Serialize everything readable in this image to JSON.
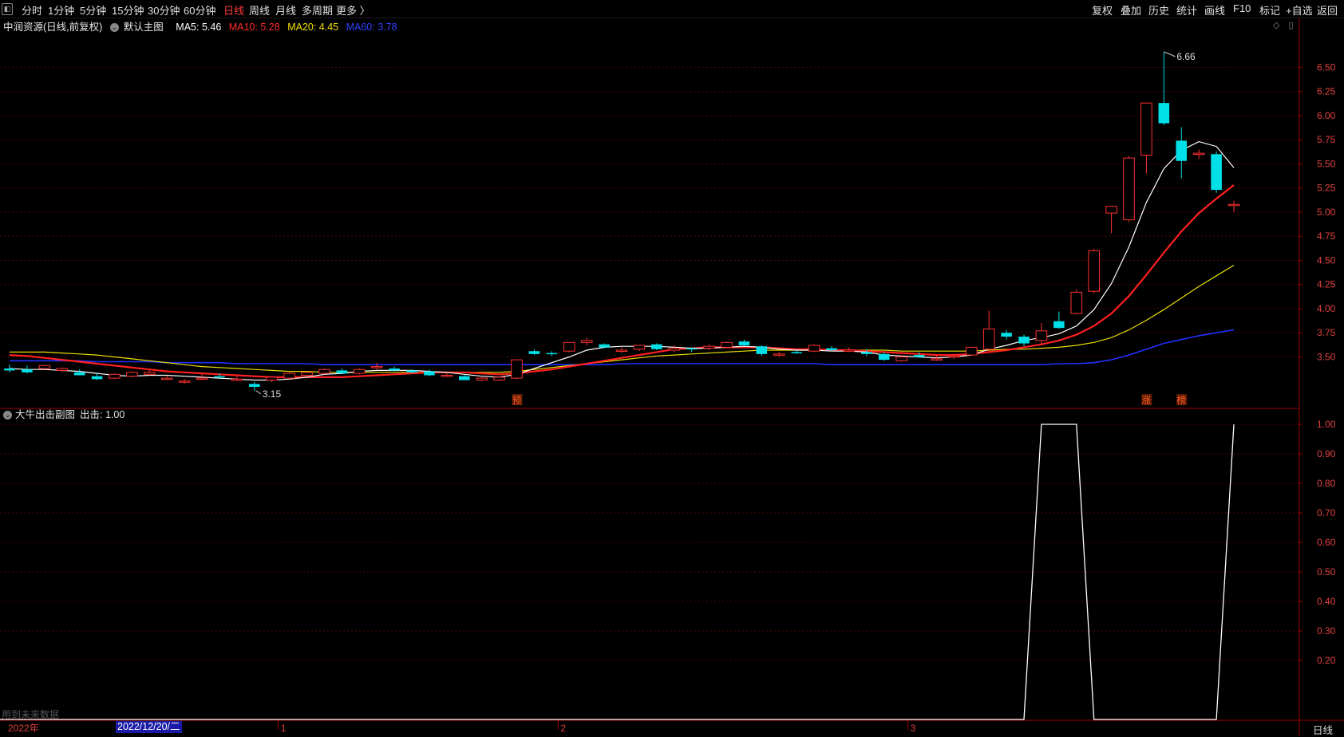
{
  "toolbar": {
    "tabs": [
      {
        "label": "分时",
        "active": false
      },
      {
        "label": "1分钟",
        "active": false
      },
      {
        "label": "5分钟",
        "active": false
      },
      {
        "label": "15分钟",
        "active": false
      },
      {
        "label": "30分钟",
        "active": false
      },
      {
        "label": "60分钟",
        "active": false
      },
      {
        "label": "日线",
        "active": true
      },
      {
        "label": "周线",
        "active": false
      },
      {
        "label": "月线",
        "active": false
      },
      {
        "label": "多周期",
        "active": false
      },
      {
        "label": "更多 〉",
        "active": false
      }
    ],
    "right_buttons": [
      "复权",
      "叠加",
      "历史",
      "统计",
      "画线",
      "F10",
      "标记",
      "+自选",
      "返回"
    ]
  },
  "main_legend": {
    "stock": "中润资源(日线,前复权)",
    "chart_name": "默认主图",
    "ma5": "MA5: 5.46",
    "ma10": "MA10: 5.28",
    "ma20": "MA20: 4.45",
    "ma60": "MA60: 3.78"
  },
  "sub_legend": {
    "name": "大牛出击副图",
    "value": "出击: 1.00"
  },
  "x_axis": {
    "year_label": "2022年",
    "cursor_date": "2022/12/20/二",
    "months": [
      "1",
      "2",
      "3"
    ]
  },
  "footer": {
    "future_data_note": "用到未来数据",
    "period": "日线"
  },
  "markers": {
    "high_label": "6.66",
    "low_label": "3.15",
    "yu": "预",
    "zhang": "涨",
    "bang": "榜"
  },
  "colors": {
    "up": "#ff3030",
    "down": "#00e0e8",
    "ma5": "#ffffff",
    "ma10": "#ff2020",
    "ma20": "#e8e000",
    "ma60": "#2030ff",
    "axis": "#a00000",
    "grid": "#5a0000"
  },
  "chart_data": [
    {
      "type": "candlestick",
      "y_ticks": [
        6.5,
        6.25,
        6.0,
        5.75,
        5.5,
        5.25,
        5.0,
        4.75,
        4.5,
        4.25,
        4.0,
        3.75,
        3.5
      ],
      "ylim": [
        3.0,
        6.85
      ],
      "candles": [
        [
          3.38,
          3.42,
          3.34,
          3.36
        ],
        [
          3.37,
          3.41,
          3.33,
          3.34
        ],
        [
          3.38,
          3.42,
          3.37,
          3.41
        ],
        [
          3.36,
          3.39,
          3.34,
          3.38
        ],
        [
          3.34,
          3.37,
          3.31,
          3.31
        ],
        [
          3.3,
          3.33,
          3.26,
          3.27
        ],
        [
          3.28,
          3.33,
          3.27,
          3.32
        ],
        [
          3.3,
          3.35,
          3.29,
          3.34
        ],
        [
          3.32,
          3.36,
          3.31,
          3.34
        ],
        [
          3.27,
          3.3,
          3.26,
          3.28
        ],
        [
          3.25,
          3.27,
          3.22,
          3.25
        ],
        [
          3.28,
          3.32,
          3.26,
          3.28
        ],
        [
          3.3,
          3.33,
          3.27,
          3.29
        ],
        [
          3.27,
          3.3,
          3.25,
          3.27
        ],
        [
          3.22,
          3.24,
          3.15,
          3.19
        ],
        [
          3.26,
          3.29,
          3.24,
          3.29
        ],
        [
          3.28,
          3.34,
          3.27,
          3.33
        ],
        [
          3.31,
          3.35,
          3.3,
          3.34
        ],
        [
          3.33,
          3.38,
          3.32,
          3.37
        ],
        [
          3.36,
          3.38,
          3.33,
          3.33
        ],
        [
          3.33,
          3.38,
          3.32,
          3.37
        ],
        [
          3.39,
          3.44,
          3.37,
          3.4
        ],
        [
          3.38,
          3.4,
          3.35,
          3.36
        ],
        [
          3.36,
          3.37,
          3.33,
          3.34
        ],
        [
          3.35,
          3.37,
          3.3,
          3.31
        ],
        [
          3.3,
          3.33,
          3.29,
          3.31
        ],
        [
          3.3,
          3.32,
          3.26,
          3.26
        ],
        [
          3.26,
          3.29,
          3.25,
          3.28
        ],
        [
          3.26,
          3.29,
          3.25,
          3.29
        ],
        [
          3.28,
          3.46,
          3.27,
          3.47
        ],
        [
          3.56,
          3.58,
          3.52,
          3.53
        ],
        [
          3.54,
          3.56,
          3.51,
          3.53
        ],
        [
          3.56,
          3.65,
          3.55,
          3.65
        ],
        [
          3.65,
          3.7,
          3.62,
          3.67
        ],
        [
          3.63,
          3.64,
          3.59,
          3.6
        ],
        [
          3.57,
          3.6,
          3.54,
          3.57
        ],
        [
          3.58,
          3.62,
          3.56,
          3.62
        ],
        [
          3.63,
          3.64,
          3.57,
          3.58
        ],
        [
          3.57,
          3.62,
          3.55,
          3.59
        ],
        [
          3.59,
          3.6,
          3.55,
          3.58
        ],
        [
          3.59,
          3.63,
          3.57,
          3.61
        ],
        [
          3.6,
          3.66,
          3.59,
          3.65
        ],
        [
          3.66,
          3.68,
          3.61,
          3.62
        ],
        [
          3.61,
          3.62,
          3.51,
          3.53
        ],
        [
          3.53,
          3.55,
          3.5,
          3.53
        ],
        [
          3.55,
          3.57,
          3.53,
          3.54
        ],
        [
          3.56,
          3.63,
          3.55,
          3.62
        ],
        [
          3.59,
          3.61,
          3.56,
          3.57
        ],
        [
          3.57,
          3.6,
          3.55,
          3.57
        ],
        [
          3.55,
          3.58,
          3.51,
          3.53
        ],
        [
          3.53,
          3.55,
          3.46,
          3.47
        ],
        [
          3.46,
          3.52,
          3.45,
          3.5
        ],
        [
          3.52,
          3.55,
          3.49,
          3.5
        ],
        [
          3.48,
          3.52,
          3.46,
          3.48
        ],
        [
          3.5,
          3.53,
          3.48,
          3.51
        ],
        [
          3.52,
          3.6,
          3.51,
          3.6
        ],
        [
          3.58,
          3.98,
          3.56,
          3.79
        ],
        [
          3.75,
          3.78,
          3.68,
          3.71
        ],
        [
          3.71,
          3.73,
          3.61,
          3.64
        ],
        [
          3.67,
          3.85,
          3.62,
          3.77
        ],
        [
          3.87,
          3.97,
          3.79,
          3.8
        ],
        [
          3.95,
          4.2,
          3.94,
          4.17
        ],
        [
          4.18,
          4.62,
          4.16,
          4.6
        ],
        [
          4.99,
          5.06,
          4.78,
          5.06
        ],
        [
          4.92,
          5.58,
          4.9,
          5.56
        ],
        [
          5.59,
          6.13,
          5.4,
          6.13
        ],
        [
          6.13,
          6.66,
          5.9,
          5.92
        ],
        [
          5.74,
          5.88,
          5.35,
          5.53
        ],
        [
          5.6,
          5.65,
          5.55,
          5.61
        ],
        [
          5.6,
          5.63,
          5.2,
          5.23
        ],
        [
          5.08,
          5.12,
          5.0,
          5.08
        ]
      ],
      "ma5": [
        3.38,
        3.37,
        3.37,
        3.36,
        3.35,
        3.33,
        3.31,
        3.3,
        3.31,
        3.31,
        3.3,
        3.29,
        3.28,
        3.27,
        3.26,
        3.26,
        3.27,
        3.29,
        3.32,
        3.33,
        3.35,
        3.36,
        3.36,
        3.36,
        3.35,
        3.34,
        3.32,
        3.3,
        3.29,
        3.32,
        3.38,
        3.44,
        3.5,
        3.57,
        3.6,
        3.61,
        3.61,
        3.61,
        3.6,
        3.59,
        3.59,
        3.6,
        3.61,
        3.6,
        3.58,
        3.57,
        3.57,
        3.56,
        3.56,
        3.55,
        3.52,
        3.51,
        3.5,
        3.49,
        3.5,
        3.52,
        3.58,
        3.62,
        3.67,
        3.7,
        3.74,
        3.82,
        3.99,
        4.26,
        4.64,
        5.1,
        5.45,
        5.64,
        5.73,
        5.68,
        5.46
      ],
      "ma10": [
        3.52,
        3.51,
        3.49,
        3.47,
        3.45,
        3.43,
        3.41,
        3.39,
        3.37,
        3.35,
        3.34,
        3.33,
        3.32,
        3.31,
        3.3,
        3.29,
        3.29,
        3.29,
        3.29,
        3.29,
        3.3,
        3.31,
        3.32,
        3.33,
        3.34,
        3.34,
        3.34,
        3.33,
        3.32,
        3.33,
        3.35,
        3.37,
        3.4,
        3.43,
        3.46,
        3.49,
        3.52,
        3.55,
        3.58,
        3.59,
        3.6,
        3.6,
        3.6,
        3.6,
        3.59,
        3.58,
        3.58,
        3.57,
        3.57,
        3.56,
        3.55,
        3.54,
        3.53,
        3.52,
        3.52,
        3.53,
        3.55,
        3.57,
        3.6,
        3.63,
        3.67,
        3.73,
        3.82,
        3.95,
        4.13,
        4.35,
        4.58,
        4.8,
        4.99,
        5.14,
        5.28
      ],
      "ma20": [
        3.55,
        3.55,
        3.55,
        3.54,
        3.53,
        3.52,
        3.5,
        3.48,
        3.46,
        3.44,
        3.42,
        3.4,
        3.39,
        3.38,
        3.37,
        3.36,
        3.35,
        3.35,
        3.34,
        3.34,
        3.34,
        3.34,
        3.34,
        3.34,
        3.34,
        3.34,
        3.34,
        3.34,
        3.34,
        3.35,
        3.37,
        3.39,
        3.41,
        3.43,
        3.45,
        3.47,
        3.49,
        3.51,
        3.52,
        3.53,
        3.54,
        3.55,
        3.56,
        3.57,
        3.57,
        3.57,
        3.57,
        3.57,
        3.57,
        3.57,
        3.57,
        3.56,
        3.56,
        3.56,
        3.56,
        3.56,
        3.57,
        3.58,
        3.58,
        3.59,
        3.6,
        3.62,
        3.65,
        3.7,
        3.78,
        3.88,
        3.99,
        4.11,
        4.23,
        4.34,
        4.45
      ],
      "ma60": [
        3.46,
        3.46,
        3.46,
        3.46,
        3.46,
        3.45,
        3.45,
        3.45,
        3.45,
        3.44,
        3.44,
        3.44,
        3.44,
        3.43,
        3.43,
        3.43,
        3.43,
        3.43,
        3.42,
        3.42,
        3.42,
        3.42,
        3.42,
        3.42,
        3.42,
        3.42,
        3.42,
        3.42,
        3.42,
        3.42,
        3.42,
        3.42,
        3.42,
        3.42,
        3.42,
        3.43,
        3.43,
        3.43,
        3.43,
        3.43,
        3.43,
        3.43,
        3.43,
        3.43,
        3.43,
        3.43,
        3.43,
        3.42,
        3.42,
        3.42,
        3.42,
        3.42,
        3.42,
        3.42,
        3.42,
        3.42,
        3.42,
        3.42,
        3.42,
        3.42,
        3.43,
        3.43,
        3.44,
        3.47,
        3.52,
        3.58,
        3.64,
        3.68,
        3.72,
        3.75,
        3.78
      ]
    },
    {
      "type": "line",
      "name": "出击",
      "y_ticks": [
        1.0,
        0.9,
        0.8,
        0.7,
        0.6,
        0.5,
        0.4,
        0.3,
        0.2
      ],
      "ylim": [
        0.0,
        1.0
      ],
      "values": [
        0,
        0,
        0,
        0,
        0,
        0,
        0,
        0,
        0,
        0,
        0,
        0,
        0,
        0,
        0,
        0,
        0,
        0,
        0,
        0,
        0,
        0,
        0,
        0,
        0,
        0,
        0,
        0,
        0,
        0,
        0,
        0,
        0,
        0,
        0,
        0,
        0,
        0,
        0,
        0,
        0,
        0,
        0,
        0,
        0,
        0,
        0,
        0,
        0,
        0,
        0,
        0,
        0,
        0,
        0,
        0,
        0,
        0,
        0,
        1,
        1,
        1,
        0,
        0,
        0,
        0,
        0,
        0,
        0,
        0,
        1
      ]
    }
  ]
}
